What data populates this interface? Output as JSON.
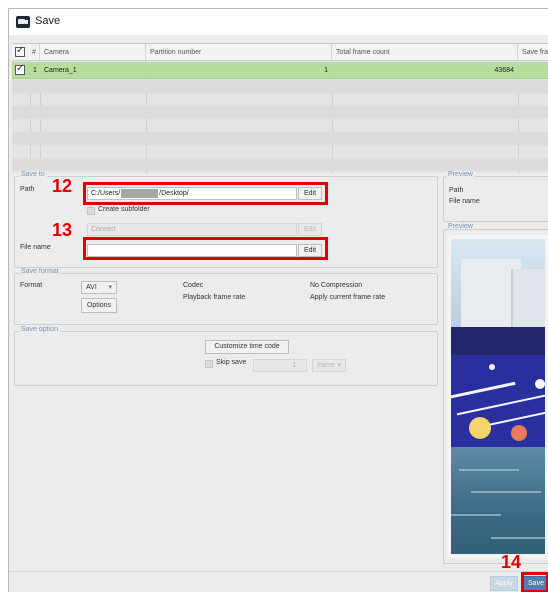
{
  "window": {
    "title": "Save"
  },
  "grid": {
    "columns": [
      "#",
      "Camera",
      "Partition number",
      "Total frame count",
      "Save fra"
    ],
    "rows": [
      {
        "checked": true,
        "index": "1",
        "camera": "Camera_1",
        "partition": "1",
        "total_frames": "43684"
      }
    ]
  },
  "save_to": {
    "legend": "Save to",
    "path_label": "Path",
    "path_prefix": "C:/Users/",
    "path_suffix": "/Desktop/",
    "path_edit": "Edit",
    "create_subfolder": "Create subfolder",
    "convert_placeholder": "Convert",
    "convert_edit": "Edit",
    "filename_label": "File name",
    "filename_value": "",
    "filename_edit": "Edit"
  },
  "preview": {
    "legend_top": "Preview",
    "path_label": "Path",
    "filename_label": "File name",
    "legend_image": "Preview"
  },
  "save_format": {
    "legend": "Save format",
    "format_label": "Format",
    "format_value": "AVI",
    "options_button": "Options",
    "codec_label": "Codec",
    "codec_value": "No Compression",
    "playback_label": "Playback frame rate",
    "playback_value": "Apply current frame rate"
  },
  "save_option": {
    "legend": "Save option",
    "customize_button": "Customize time code",
    "skip_save": "Skip save",
    "skip_value": "1",
    "skip_unit": "frame"
  },
  "footer": {
    "apply_button": "Apply",
    "save_button": "Save"
  },
  "callouts": {
    "path": "12",
    "filename": "13",
    "save": "14"
  },
  "colors": {
    "accent": "#b6dd9d",
    "callout": "#e00000",
    "legend": "#7895b3"
  }
}
